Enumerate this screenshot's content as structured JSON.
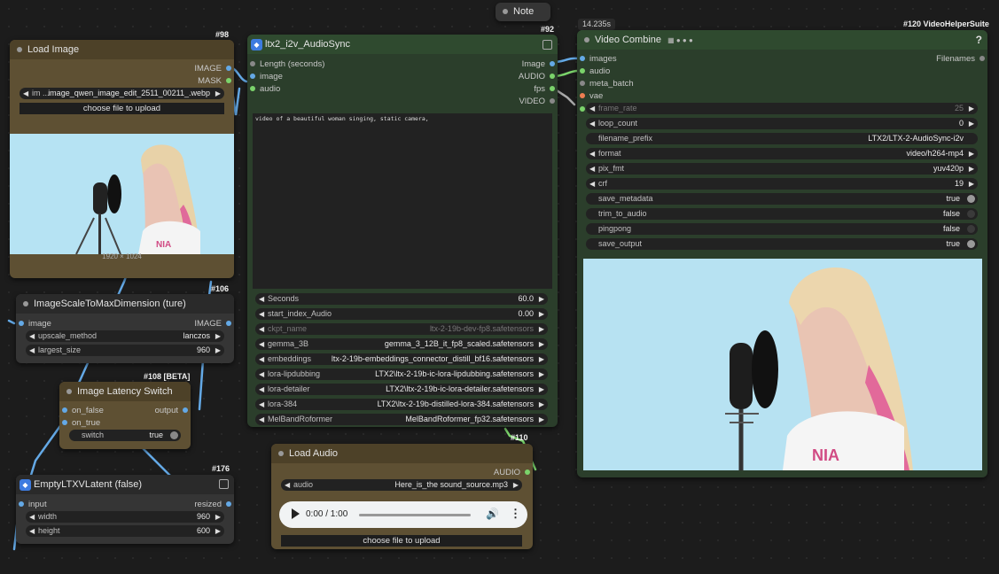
{
  "canvas": {
    "background": "#1c1c1c"
  },
  "note_node": {
    "title": "Note"
  },
  "timer_badge": "14.235s",
  "load_image": {
    "id": "#98",
    "title": "Load Image",
    "outputs": [
      "IMAGE",
      "MASK"
    ],
    "image_widget": {
      "label": "im ...",
      "value": "image_qwen_image_edit_2511_00211_.webp"
    },
    "upload_button": "choose file to upload",
    "resolution": "1920 × 1024"
  },
  "scale_node": {
    "id": "#106",
    "title": "ImageScaleToMaxDimension (ture)",
    "input": "image",
    "output": "IMAGE",
    "widgets": [
      {
        "label": "upscale_method",
        "value": "lanczos"
      },
      {
        "label": "largest_size",
        "value": "960"
      }
    ]
  },
  "latency_node": {
    "id": "#108 [BETA]",
    "title": "Image Latency Switch",
    "inputs": [
      "on_false",
      "on_true"
    ],
    "output": "output",
    "switch": {
      "label": "switch",
      "value": "true"
    }
  },
  "latent_node": {
    "id": "#176",
    "title": "EmptyLTXVLatent (false)",
    "input": "input",
    "output": "resized",
    "widgets": [
      {
        "label": "width",
        "value": "960"
      },
      {
        "label": "height",
        "value": "600"
      }
    ]
  },
  "sync_node": {
    "id": "#92",
    "title": "ltx2_i2v_AudioSync",
    "inputs": [
      "Length (seconds)",
      "image",
      "audio"
    ],
    "outputs": [
      "Image",
      "AUDIO",
      "fps",
      "VIDEO"
    ],
    "prompt": "video of a beautiful woman singing, static camera,",
    "widgets": [
      {
        "label": "Seconds",
        "value": "60.0",
        "dim": false
      },
      {
        "label": "start_index_Audio",
        "value": "0.00",
        "dim": false
      },
      {
        "label": "ckpt_name",
        "value": "ltx-2-19b-dev-fp8.safetensors",
        "dim": true
      },
      {
        "label": "gemma_3B",
        "value": "gemma_3_12B_it_fp8_scaled.safetensors",
        "dim": false
      },
      {
        "label": "embeddings",
        "value": "ltx-2-19b-embeddings_connector_distill_bf16.safetensors",
        "dim": false
      },
      {
        "label": "lora-lipdubbing",
        "value": "LTX2\\ltx-2-19b-ic-lora-lipdubbing.safetensors",
        "dim": false
      },
      {
        "label": "lora-detailer",
        "value": "LTX2\\ltx-2-19b-ic-lora-detailer.safetensors",
        "dim": false
      },
      {
        "label": "lora-384",
        "value": "LTX2\\ltx-2-19b-distilled-lora-384.safetensors",
        "dim": false
      },
      {
        "label": "MelBandRoformer",
        "value": "MelBandRoformer_fp32.safetensors",
        "dim": false
      }
    ]
  },
  "video_combine": {
    "id": "#120 VideoHelperSuite",
    "title": "Video Combine",
    "help": "?",
    "inputs": [
      "images",
      "audio",
      "meta_batch",
      "vae"
    ],
    "output": "Filenames",
    "widgets": [
      {
        "label": "frame_rate",
        "value": "25",
        "type": "number",
        "dim": true
      },
      {
        "label": "loop_count",
        "value": "0",
        "type": "number",
        "dim": false
      },
      {
        "label": "filename_prefix",
        "value": "LTX2/LTX-2-AudioSync-i2v",
        "type": "text",
        "dim": false
      },
      {
        "label": "format",
        "value": "video/h264-mp4",
        "type": "combo",
        "dim": false
      },
      {
        "label": "pix_fmt",
        "value": "yuv420p",
        "type": "combo",
        "dim": false
      },
      {
        "label": "crf",
        "value": "19",
        "type": "number",
        "dim": false
      },
      {
        "label": "save_metadata",
        "value": "true",
        "type": "toggle",
        "on": true
      },
      {
        "label": "trim_to_audio",
        "value": "false",
        "type": "toggle",
        "on": false
      },
      {
        "label": "pingpong",
        "value": "false",
        "type": "toggle",
        "on": false
      },
      {
        "label": "save_output",
        "value": "true",
        "type": "toggle",
        "on": true
      }
    ]
  },
  "load_audio": {
    "id": "#110",
    "title": "Load Audio",
    "output": "AUDIO",
    "audio_widget": {
      "label": "audio",
      "value": "Here_is_the sound_source.mp3"
    },
    "player_time": "0:00 / 1:00",
    "progress": 0,
    "upload_button": "choose file to upload"
  },
  "colors": {
    "node_green": "#2b3e2b",
    "node_green_title": "#2f4a2f",
    "node_brown": "#5e5033",
    "node_brown_title": "#4d4128",
    "node_gray": "#353535",
    "node_gray_title": "#2a2a2a",
    "link_blue": "#64a9e6",
    "slot_green": "#7bd36b",
    "slot_orange": "#ef7e52"
  }
}
